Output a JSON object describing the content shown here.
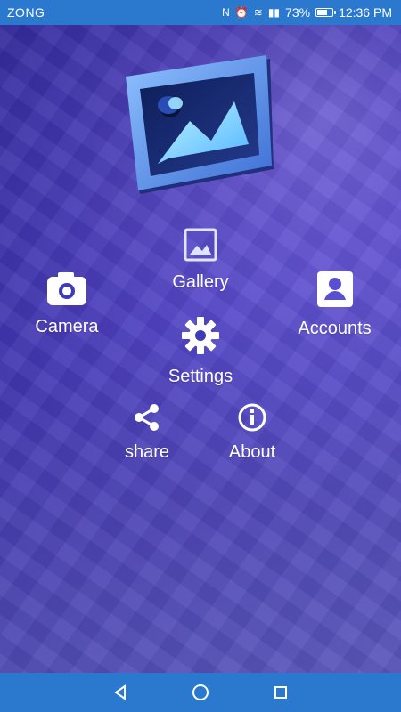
{
  "status": {
    "carrier": "ZONG",
    "battery": "73%",
    "time": "12:36 PM"
  },
  "menu": {
    "gallery": "Gallery",
    "camera": "Camera",
    "accounts": "Accounts",
    "settings": "Settings",
    "share": "share",
    "about": "About"
  },
  "icons": {
    "gallery": "image-icon",
    "camera": "camera-icon",
    "accounts": "account-box-icon",
    "settings": "gear-icon",
    "share": "share-icon",
    "about": "info-icon"
  },
  "colors": {
    "accent": "#2b78cf"
  }
}
